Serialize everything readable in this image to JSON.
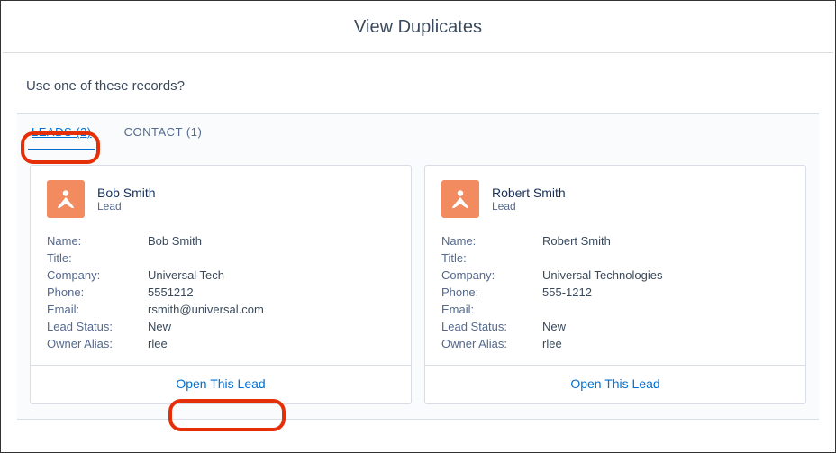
{
  "title": "View Duplicates",
  "prompt": "Use one of these records?",
  "tabs": {
    "leads": "LEADS (2)",
    "contact": "CONTACT (1)"
  },
  "labels": {
    "name": "Name:",
    "title": "Title:",
    "company": "Company:",
    "phone": "Phone:",
    "email": "Email:",
    "status": "Lead Status:",
    "owner": "Owner Alias:"
  },
  "actions": {
    "open": "Open This Lead"
  },
  "records": [
    {
      "headName": "Bob Smith",
      "headSub": "Lead",
      "name": "Bob Smith",
      "title": "",
      "company": "Universal Tech",
      "phone": "5551212",
      "email": "rsmith@universal.com",
      "status": "New",
      "owner": "rlee"
    },
    {
      "headName": "Robert Smith",
      "headSub": "Lead",
      "name": "Robert Smith",
      "title": "",
      "company": "Universal Technologies",
      "phone": "555-1212",
      "email": "",
      "status": "New",
      "owner": "rlee"
    }
  ]
}
